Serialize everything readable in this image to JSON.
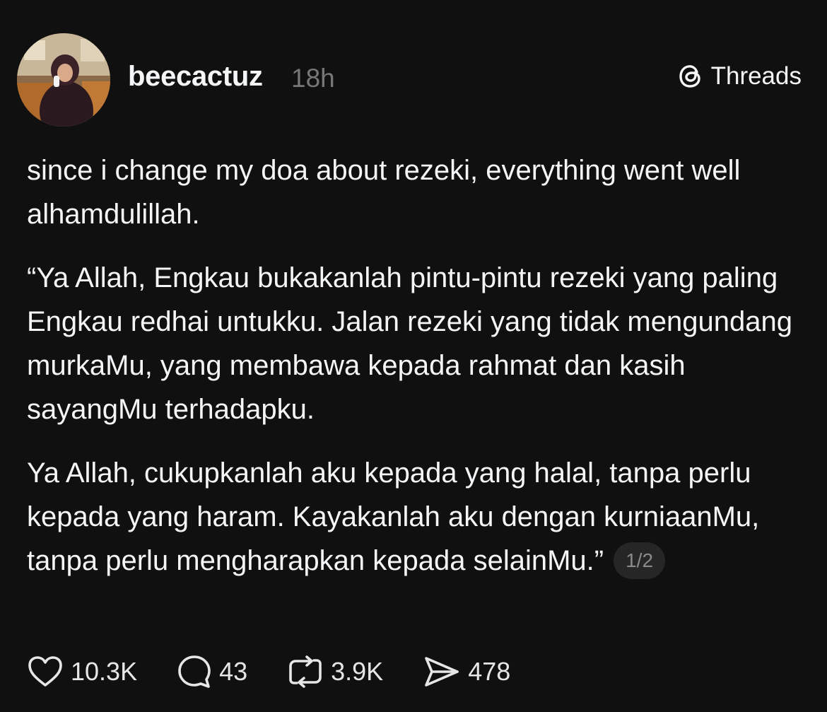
{
  "post": {
    "username": "beecactuz",
    "time": "18h",
    "brand": "Threads",
    "paragraphs": [
      "since i change my doa about rezeki, everything went well alhamdulillah.",
      "“Ya Allah, Engkau bukakanlah pintu-pintu rezeki yang paling Engkau redhai untukku. Jalan rezeki yang tidak mengundang murkaMu, yang membawa kepada rahmat dan kasih sayangMu terhadapku.",
      "Ya Allah, cukupkanlah aku kepada yang halal, tanpa perlu kepada yang haram. Kayakanlah aku dengan kurniaanMu, tanpa perlu mengharapkan kepada selainMu.”"
    ],
    "page_indicator": "1/2"
  },
  "actions": {
    "likes": "10.3K",
    "replies": "43",
    "reposts": "3.9K",
    "shares": "478"
  },
  "icons": {
    "like": "heart-icon",
    "reply": "speech-bubble-icon",
    "repost": "repost-arrows-icon",
    "share": "paper-plane-icon",
    "brand": "threads-logo-icon"
  },
  "colors": {
    "background": "#101010",
    "text": "#f3f5f7",
    "muted": "#777777",
    "badge_bg": "#262626"
  }
}
